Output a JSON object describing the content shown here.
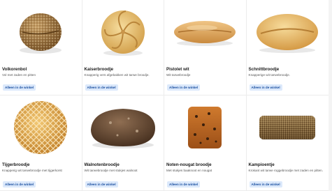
{
  "products": [
    {
      "name": "Volkorenbol",
      "desc": "Vol met zaden en pitten",
      "button": "Alleen in de winkel"
    },
    {
      "name": "Kaiserbroodje",
      "desc": "Knapperig vers afgebakken wit tarwe broodje.",
      "button": "Alleen in de winkel"
    },
    {
      "name": "Pistolet wit",
      "desc": "Wit tarwebroodje",
      "button": "Alleen in de winkel"
    },
    {
      "name": "Schnittbroodje",
      "desc": "Knapperige wit tarwebroodje.",
      "button": "Alleen in de winkel"
    },
    {
      "name": "Tijgerbroodje",
      "desc": "Knapperig wit tarwebroodje met tijgerkorst",
      "button": "Alleen in de winkel"
    },
    {
      "name": "Walnotenbroodje",
      "desc": "Wit tarwebroodje met stukjes walnoot",
      "button": "Alleen in de winkel"
    },
    {
      "name": "Noten-nougat broodje",
      "desc": "Met stukjes baaknoot en nougat",
      "button": "Alleen in de winkel"
    },
    {
      "name": "Kampioentje",
      "desc": "Krokant wit tarwe roggebroodje met zaden en pitten.",
      "button": "Alleen in de winkel"
    }
  ]
}
